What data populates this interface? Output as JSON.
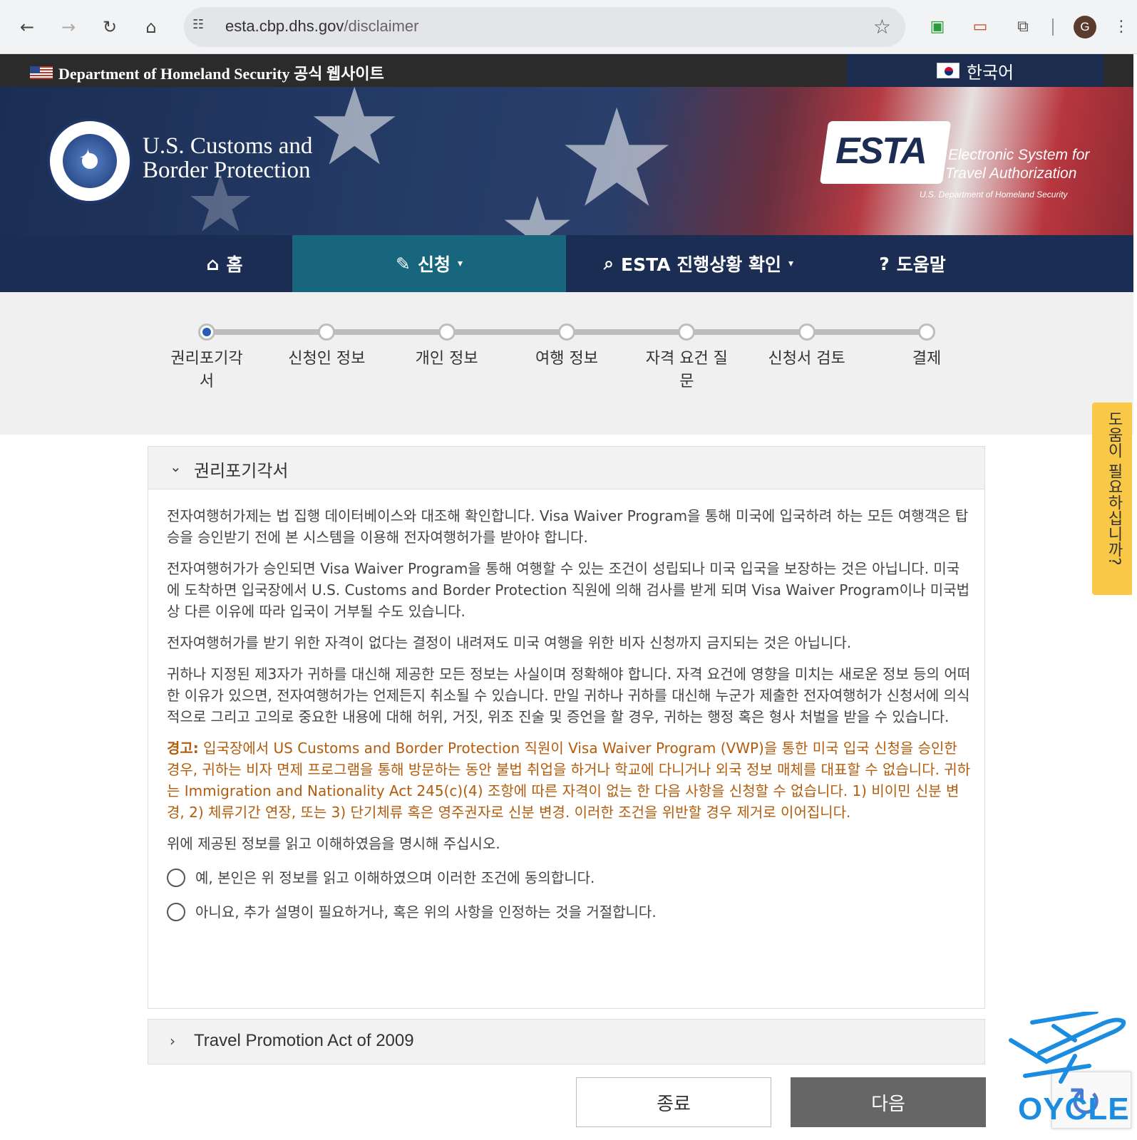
{
  "browser": {
    "url_domain": "esta.cbp.dhs.gov",
    "url_path": "/disclaimer",
    "profile_initial": "G"
  },
  "banner": {
    "official_text": "Department of Homeland Security 공식 웹사이트",
    "language": "한국어"
  },
  "header": {
    "agency_line1": "U.S. Customs and",
    "agency_line2": "Border Protection",
    "esta_word": "ESTA",
    "esta_tag_line1": "Electronic System for",
    "esta_tag_line2": "Travel Authorization",
    "esta_tag_line3": "U.S. Department of Homeland Security"
  },
  "nav": {
    "home": "홈",
    "apply": "신청",
    "status": "ESTA 진행상황 확인",
    "help": "도움말"
  },
  "steps": [
    {
      "line1": "권리포기각",
      "line2": "서"
    },
    {
      "line1": "신청인 정보",
      "line2": ""
    },
    {
      "line1": "개인 정보",
      "line2": ""
    },
    {
      "line1": "여행 정보",
      "line2": ""
    },
    {
      "line1": "자격 요건 질",
      "line2": "문"
    },
    {
      "line1": "신청서 검토",
      "line2": ""
    },
    {
      "line1": "결제",
      "line2": ""
    }
  ],
  "current_step": 1,
  "help_tab": "도움이 필요하십니까?",
  "disclaimer": {
    "title": "권리포기각서",
    "p1": "전자여행허가제는 법 집행 데이터베이스와 대조해 확인합니다. Visa Waiver Program을 통해 미국에 입국하려 하는 모든 여행객은 탑승을 승인받기 전에 본 시스템을 이용해 전자여행허가를 받아야 합니다.",
    "p2": "전자여행허가가 승인되면 Visa Waiver Program을 통해 여행할 수 있는 조건이 성립되나 미국 입국을 보장하는 것은 아닙니다. 미국에 도착하면 입국장에서 U.S. Customs and Border Protection 직원에 의해 검사를 받게 되며 Visa Waiver Program이나 미국법상 다른 이유에 따라 입국이 거부될 수도 있습니다.",
    "p3": "전자여행허가를 받기 위한 자격이 없다는 결정이 내려져도 미국 여행을 위한 비자 신청까지 금지되는 것은 아닙니다.",
    "p4": "귀하나 지정된 제3자가 귀하를 대신해 제공한 모든 정보는 사실이며 정확해야 합니다. 자격 요건에 영향을 미치는 새로운 정보 등의 어떠한 이유가 있으면, 전자여행허가는 언제든지 취소될 수 있습니다. 만일 귀하나 귀하를 대신해 누군가 제출한 전자여행허가 신청서에 의식적으로 그리고 고의로 중요한 내용에 대해 허위, 거짓, 위조 진술 및 증언을 할 경우, 귀하는 행정 혹은 형사 처벌을 받을 수 있습니다.",
    "warning_label": "경고:",
    "warning_text": " 입국장에서 US Customs and Border Protection 직원이 Visa Waiver Program (VWP)을 통한 미국 입국 신청을 승인한 경우, 귀하는 비자 면제 프로그램을 통해 방문하는 동안 불법 취업을 하거나 학교에 다니거나 외국 정보 매체를 대표할 수 없습니다. 귀하는 Immigration and Nationality Act 245(c)(4) 조항에 따른 자격이 없는 한 다음 사항을 신청할 수 없습니다. 1) 비이민 신분 변경, 2) 체류기간 연장, 또는 3) 단기체류 혹은 영주권자로 신분 변경. 이러한 조건을 위반할 경우 제거로 이어집니다.",
    "confirm_prompt": "위에 제공된 정보를 읽고 이해하였음을 명시해 주십시오.",
    "option_yes": "예, 본인은 위 정보를 읽고 이해하였으며 이러한 조건에 동의합니다.",
    "option_no": "아니요, 추가 설명이 필요하거나, 혹은 위의 사항을 인정하는 것을 거절합니다."
  },
  "travel_promotion": {
    "title": "Travel Promotion Act of 2009"
  },
  "buttons": {
    "exit": "종료",
    "next": "다음"
  },
  "watermark": "OYCLE",
  "colors": {
    "navy": "#1b2d52",
    "active_tab": "#17667e",
    "warning": "#b35c0c",
    "help_tab": "#f9c846",
    "next_button": "#666666"
  }
}
